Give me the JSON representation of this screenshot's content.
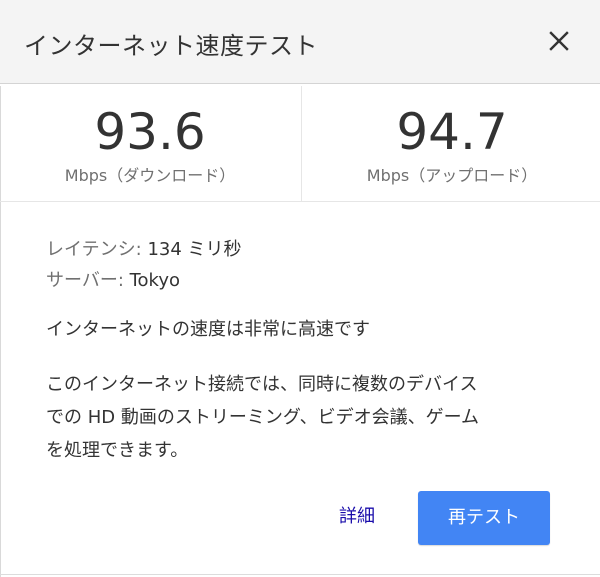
{
  "dialog": {
    "title": "インターネット速度テスト"
  },
  "results": {
    "download": {
      "value": "93.6",
      "unit": "Mbps（ダウンロード）"
    },
    "upload": {
      "value": "94.7",
      "unit": "Mbps（アップロード）"
    }
  },
  "info": {
    "latency_label": "レイテンシ:",
    "latency_value": " 134 ミリ秒",
    "server_label": "サーバー:",
    "server_value": " Tokyo"
  },
  "summary": "インターネットの速度は非常に高速です",
  "description": {
    "line1": "このインターネット接続では、同時に複数のデバイス",
    "line2": "での HD 動画のストリーミング、ビデオ会議、ゲーム",
    "line3": "を処理できます。"
  },
  "actions": {
    "details_label": "詳細",
    "retest_label": "再テスト"
  },
  "colors": {
    "primary_button": "#4285f4",
    "link": "#1a0dab",
    "header_bg": "#f4f4f4"
  },
  "icons": {
    "close": "close-icon"
  }
}
